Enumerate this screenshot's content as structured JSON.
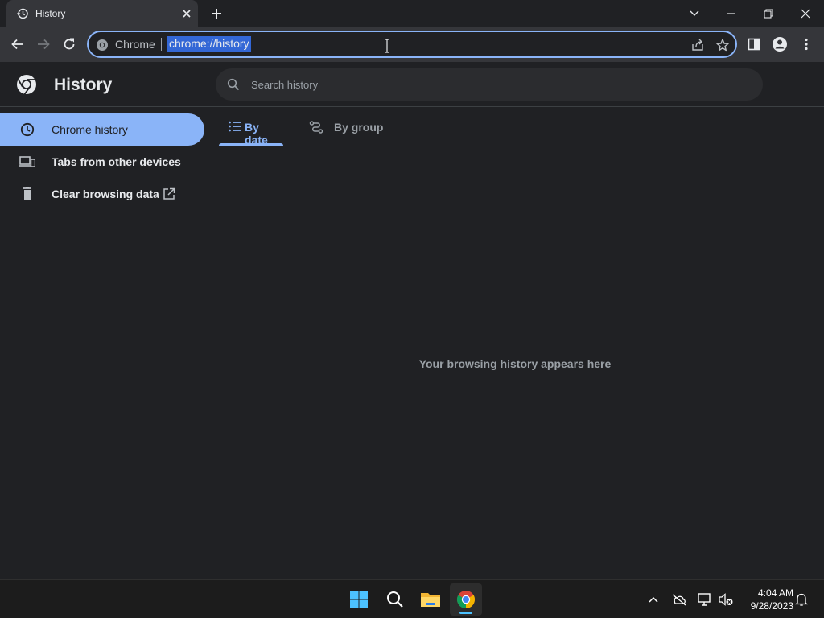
{
  "browser": {
    "tab_title": "History",
    "omnibox_chip": "Chrome",
    "url": "chrome://history",
    "colors": {
      "accent": "#8ab4f8",
      "background": "#202124",
      "toolbar": "#35363a",
      "selection": "#3367d6"
    }
  },
  "page": {
    "title": "History",
    "search_placeholder": "Search history"
  },
  "sidebar": {
    "items": [
      {
        "label": "Chrome history",
        "icon": "clock-icon",
        "active": true
      },
      {
        "label": "Tabs from other devices",
        "icon": "devices-icon",
        "active": false
      },
      {
        "label": "Clear browsing data",
        "icon": "trash-icon",
        "active": false
      }
    ]
  },
  "tabs": [
    {
      "label": "By date",
      "icon": "list-icon",
      "active": true
    },
    {
      "label": "By group",
      "icon": "group-icon",
      "active": false
    }
  ],
  "main": {
    "empty_message": "Your browsing history appears here"
  },
  "taskbar": {
    "apps": [
      "windows-start-icon",
      "search-icon",
      "file-explorer-icon",
      "chrome-icon"
    ],
    "time": "4:04 AM",
    "date": "9/28/2023"
  }
}
